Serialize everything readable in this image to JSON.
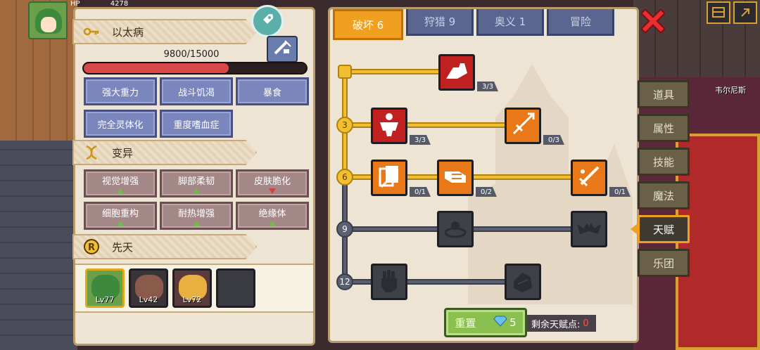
{
  "background": {
    "hp_label": "HP",
    "hp_value": "4278",
    "location_label": "韦尔尼斯"
  },
  "left_panel": {
    "disease": {
      "title": "以太病",
      "progress_text": "9800/15000",
      "progress_value": 9800,
      "progress_max": 15000,
      "traits": [
        "强大重力",
        "战斗饥渴",
        "暴食",
        "完全灵体化",
        "重度嗜血症"
      ]
    },
    "mutation": {
      "title": "变异",
      "items": [
        {
          "label": "视觉增强",
          "trend": "up"
        },
        {
          "label": "脚部柔韧",
          "trend": "up"
        },
        {
          "label": "皮肤脆化",
          "trend": "down"
        },
        {
          "label": "细胞重构",
          "trend": "up"
        },
        {
          "label": "耐热增强",
          "trend": "up"
        },
        {
          "label": "绝缘体",
          "trend": "up"
        }
      ]
    },
    "innate": {
      "title": "先天",
      "slots": [
        {
          "level": "Lv77",
          "selected": true
        },
        {
          "level": "Lv42",
          "selected": false
        },
        {
          "level": "Lv72",
          "selected": false
        },
        {
          "level": "",
          "selected": false
        }
      ]
    }
  },
  "right_panel": {
    "tabs": [
      {
        "label": "破坏 6",
        "active": true
      },
      {
        "label": "狩猎 9",
        "active": false
      },
      {
        "label": "奥义 1",
        "active": false
      },
      {
        "label": "冒险",
        "active": false
      }
    ],
    "tiers": [
      "3",
      "6",
      "9",
      "12"
    ],
    "talents": [
      {
        "id": "arm-wrestle",
        "count": "3/3"
      },
      {
        "id": "muscle-body",
        "count": "3/3"
      },
      {
        "id": "arrow-strike",
        "count": "0/3"
      },
      {
        "id": "card-swap",
        "count": "0/1"
      },
      {
        "id": "fist-punch",
        "count": "0/2"
      },
      {
        "id": "sword-slash",
        "count": "0/1"
      }
    ],
    "reset_label": "重置",
    "reset_cost": "5",
    "points_label": "剩余天赋点:",
    "points_value": "0"
  },
  "side_menu": {
    "items": [
      {
        "label": "道具",
        "active": false
      },
      {
        "label": "属性",
        "active": false
      },
      {
        "label": "技能",
        "active": false
      },
      {
        "label": "魔法",
        "active": false
      },
      {
        "label": "天赋",
        "active": true
      },
      {
        "label": "乐团",
        "active": false
      }
    ]
  },
  "colors": {
    "accent": "#f0a020",
    "progress": "#d84848",
    "trait_bg": "#7a86bc",
    "mutation_bg": "#a48888"
  }
}
